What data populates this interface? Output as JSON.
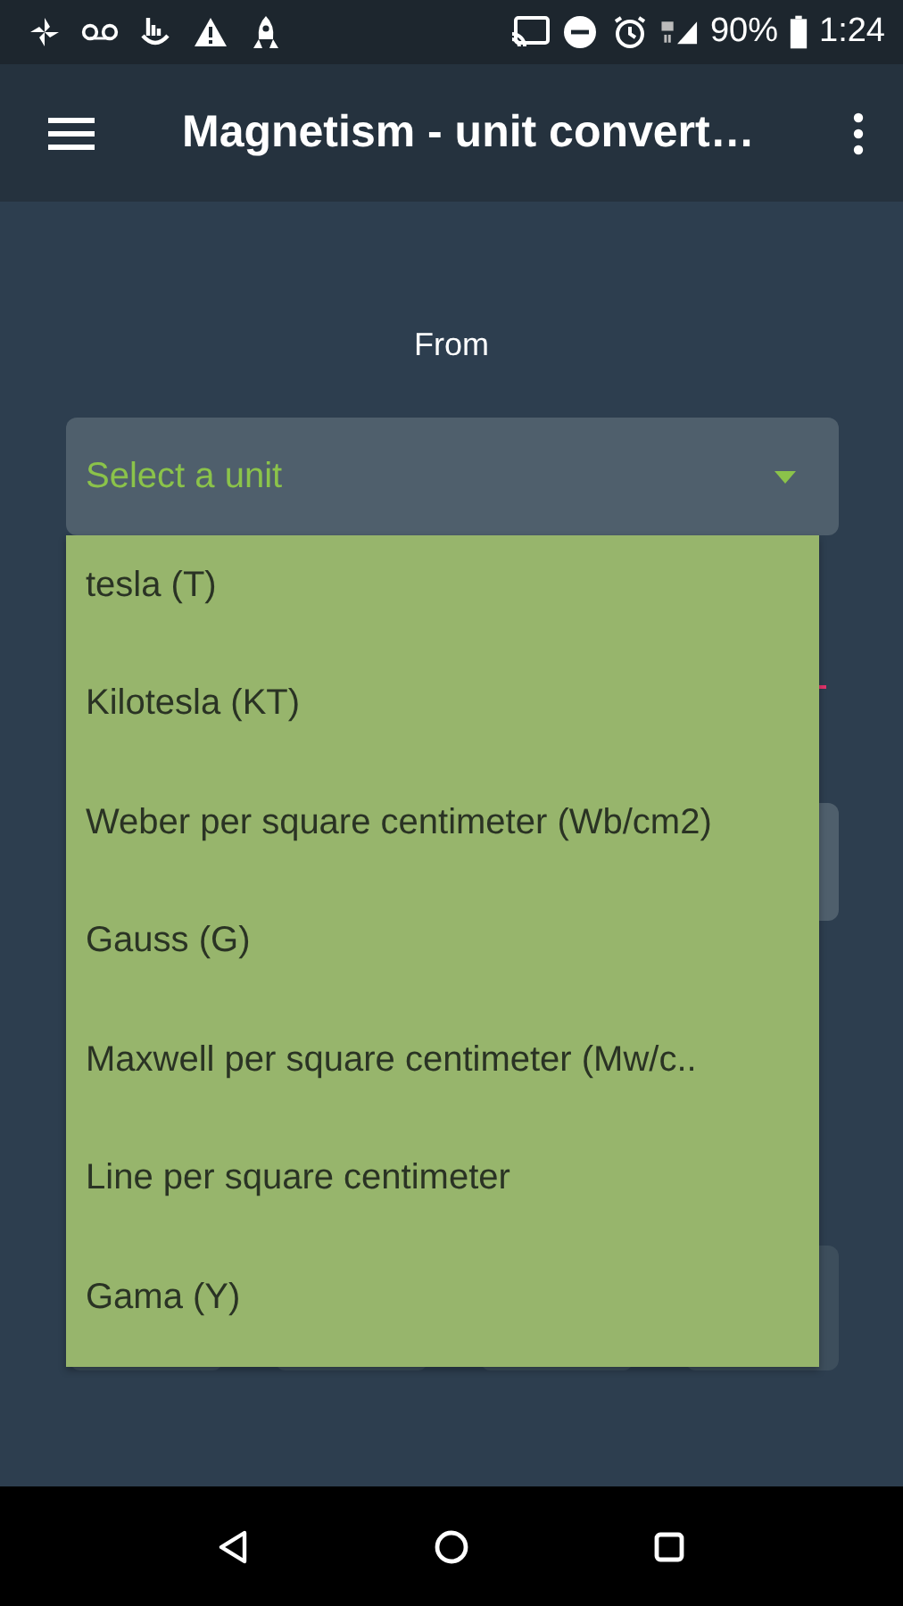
{
  "status_bar": {
    "battery": "90%",
    "time": "1:24"
  },
  "app_bar": {
    "title": "Magnetism - unit convert…"
  },
  "from_label": "From",
  "from_select": {
    "placeholder": "Select a unit",
    "expanded": true
  },
  "options": [
    {
      "label": "tesla (T)",
      "selected": false
    },
    {
      "label": "Kilotesla (KT)",
      "selected": false
    },
    {
      "label": "Weber per square centimeter (Wb/cm2)",
      "selected": false
    },
    {
      "label": "Gauss (G)",
      "selected": false
    },
    {
      "label": "Maxwell per square centimeter (Mw/c..",
      "selected": false
    },
    {
      "label": "Line per square centimeter",
      "selected": false
    },
    {
      "label": "Gama (Y)",
      "selected": false
    }
  ]
}
